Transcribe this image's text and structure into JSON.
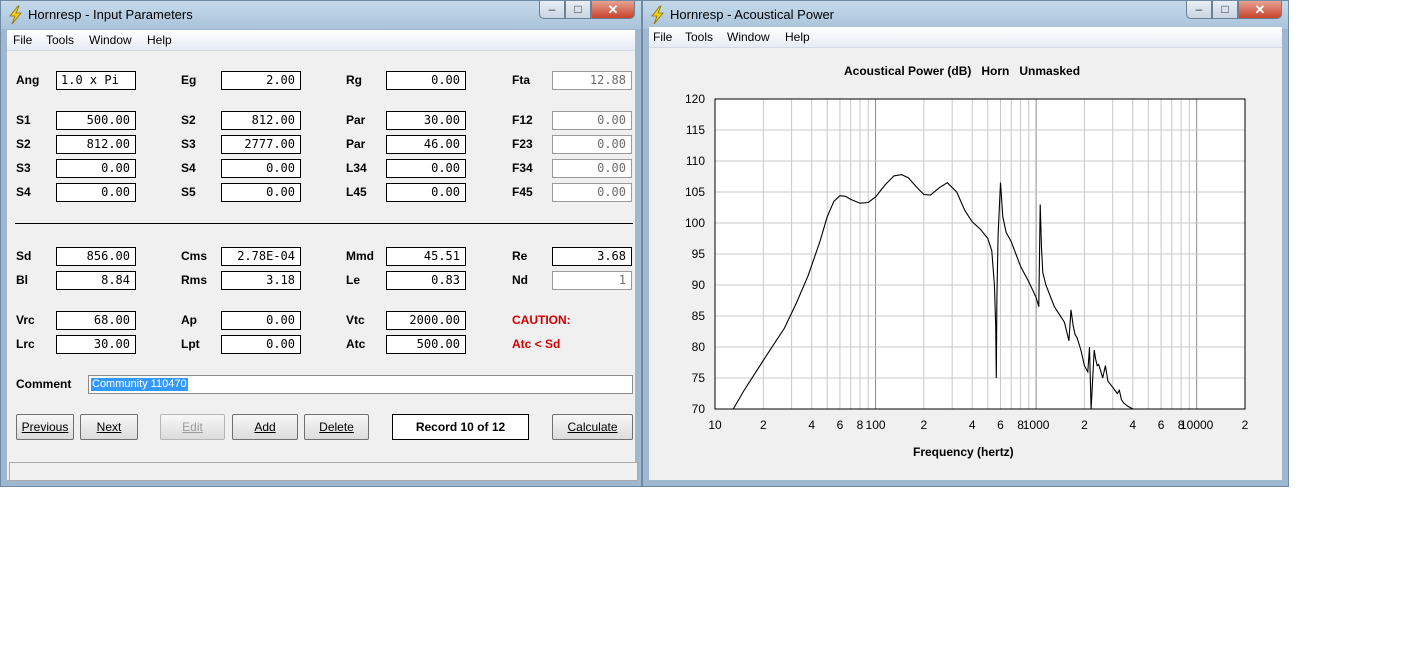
{
  "input_window": {
    "title": "Hornresp - Input Parameters",
    "menu": [
      "File",
      "Tools",
      "Window",
      "Help"
    ],
    "params": {
      "row1": [
        {
          "label": "Ang",
          "value": "1.0 x Pi"
        },
        {
          "label": "Eg",
          "value": "2.00"
        },
        {
          "label": "Rg",
          "value": "0.00"
        },
        {
          "label": "Fta",
          "value": "12.88"
        }
      ],
      "row2": [
        {
          "label": "S1",
          "value": "500.00"
        },
        {
          "label": "S2",
          "value": "812.00"
        },
        {
          "label": "Par",
          "value": "30.00"
        },
        {
          "label": "F12",
          "value": "0.00"
        }
      ],
      "row3": [
        {
          "label": "S2",
          "value": "812.00"
        },
        {
          "label": "S3",
          "value": "2777.00"
        },
        {
          "label": "Par",
          "value": "46.00"
        },
        {
          "label": "F23",
          "value": "0.00"
        }
      ],
      "row4": [
        {
          "label": "S3",
          "value": "0.00"
        },
        {
          "label": "S4",
          "value": "0.00"
        },
        {
          "label": "L34",
          "value": "0.00"
        },
        {
          "label": "F34",
          "value": "0.00"
        }
      ],
      "row5": [
        {
          "label": "S4",
          "value": "0.00"
        },
        {
          "label": "S5",
          "value": "0.00"
        },
        {
          "label": "L45",
          "value": "0.00"
        },
        {
          "label": "F45",
          "value": "0.00"
        }
      ],
      "row6": [
        {
          "label": "Sd",
          "value": "856.00"
        },
        {
          "label": "Cms",
          "value": "2.78E-04"
        },
        {
          "label": "Mmd",
          "value": "45.51"
        },
        {
          "label": "Re",
          "value": "3.68"
        }
      ],
      "row7": [
        {
          "label": "Bl",
          "value": "8.84"
        },
        {
          "label": "Rms",
          "value": "3.18"
        },
        {
          "label": "Le",
          "value": "0.83"
        },
        {
          "label": "Nd",
          "value": "1"
        }
      ],
      "row8": [
        {
          "label": "Vrc",
          "value": "68.00"
        },
        {
          "label": "Ap",
          "value": "0.00"
        },
        {
          "label": "Vtc",
          "value": "2000.00"
        }
      ],
      "row9": [
        {
          "label": "Lrc",
          "value": "30.00"
        },
        {
          "label": "Lpt",
          "value": "0.00"
        },
        {
          "label": "Atc",
          "value": "500.00"
        }
      ]
    },
    "caution": "CAUTION:",
    "caution_detail": "Atc < Sd",
    "comment_label": "Comment",
    "comment_value": "Community 110470",
    "buttons": {
      "previous": "Previous",
      "next": "Next",
      "edit": "Edit",
      "add": "Add",
      "delete": "Delete",
      "calculate": "Calculate"
    },
    "record": "Record 10 of 12"
  },
  "chart_window": {
    "title": "Hornresp - Acoustical Power",
    "menu": [
      "File",
      "Tools",
      "Window",
      "Help"
    ]
  },
  "chart_data": {
    "type": "line",
    "title": "Acoustical Power (dB)   Horn   Unmasked",
    "xlabel": "Frequency (hertz)",
    "ylabel": "",
    "xscale": "log",
    "xlim": [
      10,
      20000
    ],
    "ylim": [
      70,
      120
    ],
    "yticks": [
      70,
      75,
      80,
      85,
      90,
      95,
      100,
      105,
      110,
      115,
      120
    ],
    "xtick_labels": [
      {
        "x": 10,
        "label": "10"
      },
      {
        "x": 20,
        "label": "2"
      },
      {
        "x": 40,
        "label": "4"
      },
      {
        "x": 60,
        "label": "6"
      },
      {
        "x": 80,
        "label": "8"
      },
      {
        "x": 100,
        "label": "100"
      },
      {
        "x": 200,
        "label": "2"
      },
      {
        "x": 400,
        "label": "4"
      },
      {
        "x": 600,
        "label": "6"
      },
      {
        "x": 800,
        "label": "8"
      },
      {
        "x": 1000,
        "label": "1000"
      },
      {
        "x": 2000,
        "label": "2"
      },
      {
        "x": 4000,
        "label": "4"
      },
      {
        "x": 6000,
        "label": "6"
      },
      {
        "x": 8000,
        "label": "8"
      },
      {
        "x": 10000,
        "label": "10000"
      },
      {
        "x": 20000,
        "label": "2"
      }
    ],
    "grid": true,
    "series": [
      {
        "x": [
          13,
          15,
          18,
          22,
          27,
          32,
          38,
          45,
          50,
          55,
          60,
          65,
          70,
          80,
          90,
          100,
          115,
          130,
          145,
          160,
          180,
          200,
          220,
          250,
          280,
          320,
          360,
          400,
          450,
          500,
          530,
          550,
          560,
          565,
          570,
          580,
          600,
          620,
          650,
          700,
          800,
          900,
          1000,
          1040,
          1060,
          1080,
          1100,
          1150,
          1300,
          1500,
          1600,
          1650,
          1700,
          1750,
          1800,
          1900,
          2000,
          2100,
          2150,
          2200,
          2300,
          2350,
          2400,
          2450,
          2500,
          2600,
          2700,
          2800,
          3000,
          3200,
          3300,
          3400,
          3500,
          3700,
          4000
        ],
        "y": [
          70.0,
          72.8,
          76.0,
          79.5,
          83.0,
          87.0,
          91.5,
          97.0,
          101.0,
          103.5,
          104.4,
          104.3,
          103.8,
          103.2,
          103.3,
          104.2,
          106.2,
          107.6,
          107.8,
          107.3,
          105.8,
          104.6,
          104.5,
          105.7,
          106.5,
          105.0,
          102.0,
          100.2,
          99.0,
          97.5,
          95.5,
          90.0,
          83.5,
          75.0,
          88.0,
          98.0,
          106.5,
          101.0,
          98.5,
          97.0,
          93.0,
          90.5,
          88.0,
          86.5,
          103.0,
          96.0,
          92.0,
          90.0,
          86.5,
          84.0,
          81.0,
          86.0,
          83.5,
          82.0,
          81.5,
          79.5,
          77.0,
          76.0,
          80.0,
          70.0,
          79.5,
          78.0,
          77.0,
          77.2,
          76.5,
          75.0,
          77.0,
          74.5,
          73.5,
          72.5,
          73.0,
          71.5,
          71.0,
          70.5,
          70.0
        ]
      }
    ]
  }
}
